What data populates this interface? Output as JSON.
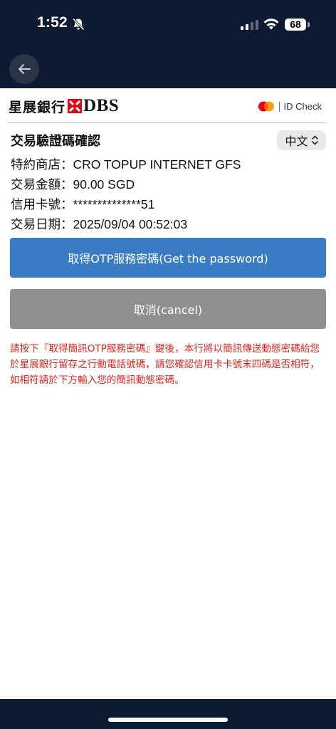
{
  "status_bar": {
    "time": "1:52",
    "battery": "68"
  },
  "header": {
    "bank_logo_cn": "星展銀行",
    "bank_logo_en": "DBS",
    "id_check_label": "ID Check"
  },
  "page": {
    "title": "交易驗證碼確認",
    "language": "中文"
  },
  "transaction": {
    "merchant_label": "特約商店：",
    "merchant_value": "CRO TOPUP INTERNET GFS",
    "amount_label": "交易金額：",
    "amount_value": "90.00 SGD",
    "card_label": "信用卡號：",
    "card_value": "**************51",
    "date_label": "交易日期：",
    "date_value": "2025/09/04 00:52:03"
  },
  "buttons": {
    "get_password": "取得OTP服務密碼(Get the password)",
    "cancel": "取消(cancel)"
  },
  "note": "請按下『取得簡訊OTP服務密碼』鍵後，本行將以簡訊傳送動態密碼給您於星展銀行留存之行動電話號碼，請您確認信用卡卡號末四碼是否相符，如相符請於下方輸入您的簡訊動態密碼。",
  "colors": {
    "background_dark": "#0d1a33",
    "primary_button": "#3a7cc3",
    "cancel_button": "#8f8f8f",
    "note_text": "#e0241c"
  }
}
